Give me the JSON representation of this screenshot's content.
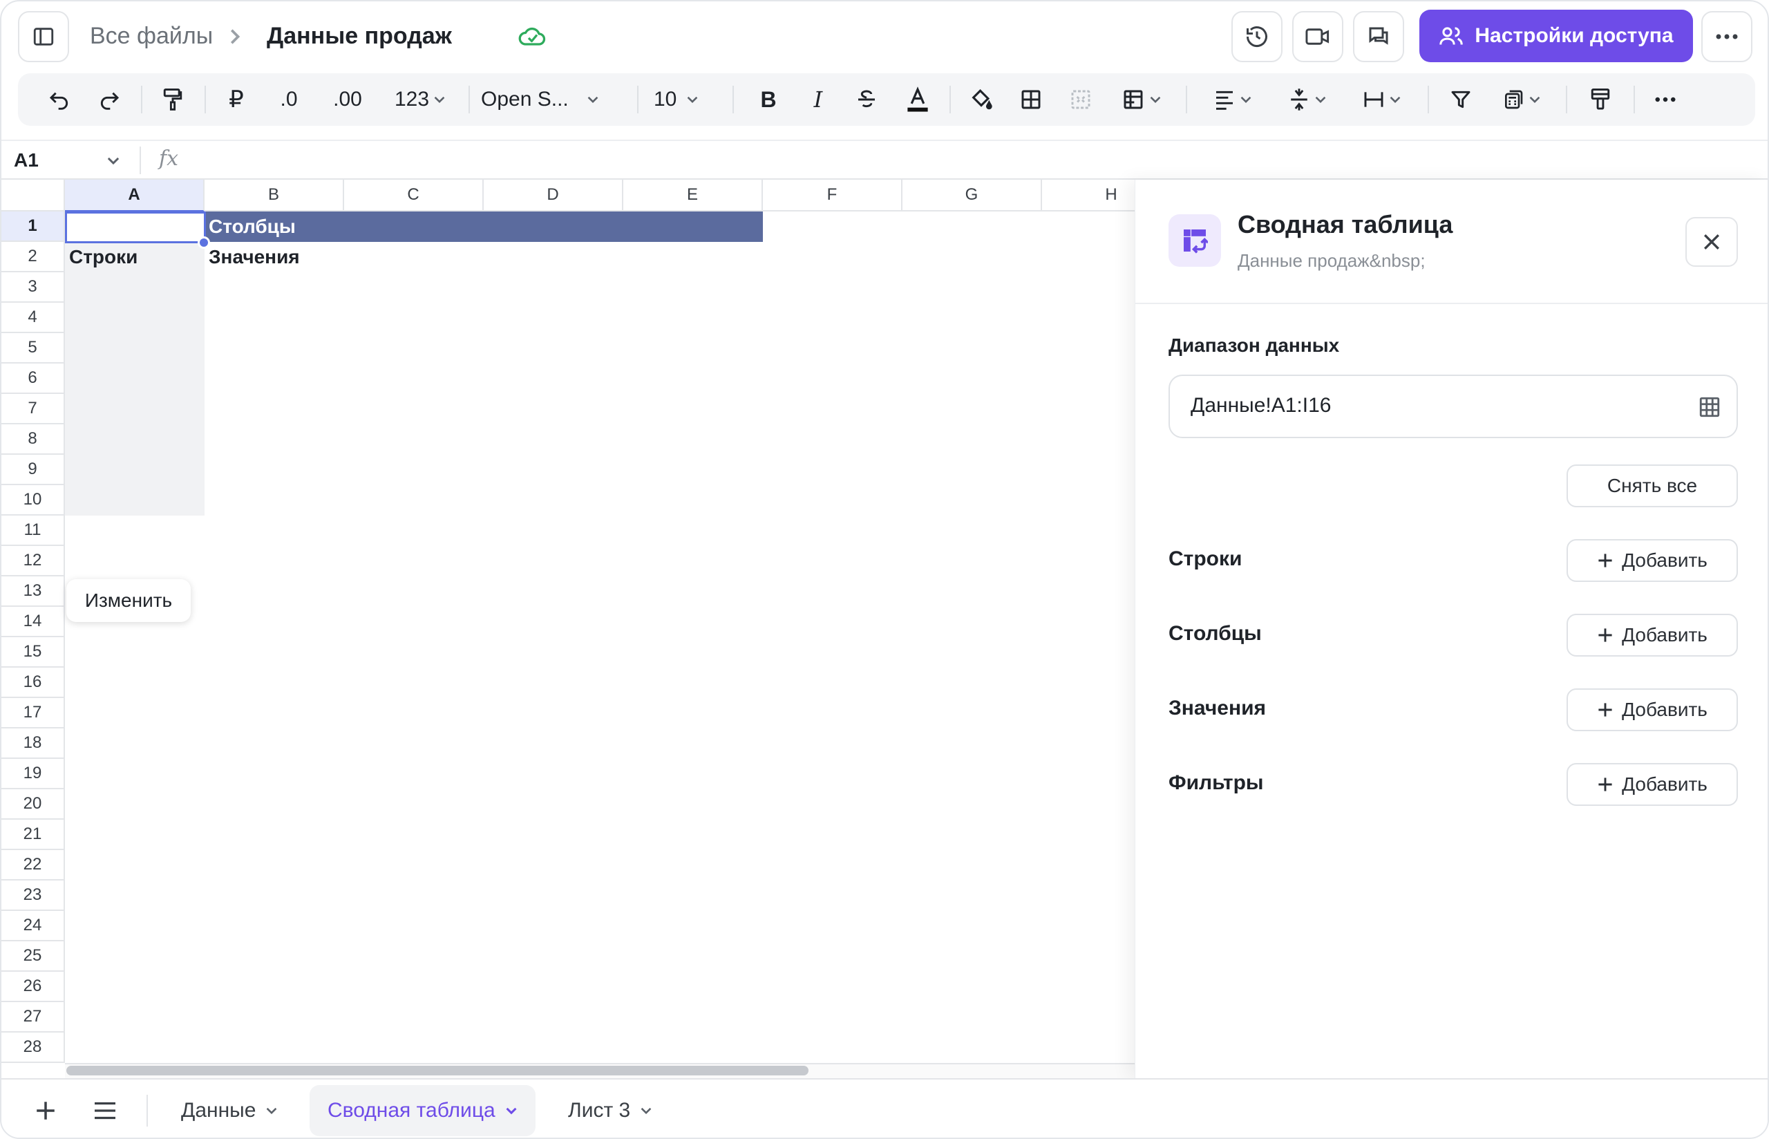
{
  "header": {
    "breadcrumb_root": "Все файлы",
    "file_title": "Данные продаж",
    "share_label": "Настройки доступа"
  },
  "toolbar": {
    "decrease_decimals": ".0",
    "increase_decimals": ".00",
    "number_format": "123",
    "font_name": "Open S...",
    "font_size": "10"
  },
  "formula_bar": {
    "cell_ref": "A1",
    "fx": "fx"
  },
  "grid": {
    "columns": [
      "A",
      "B",
      "C",
      "D",
      "E",
      "F",
      "G",
      "H"
    ],
    "rows": [
      "1",
      "2",
      "3",
      "4",
      "5",
      "6",
      "7",
      "8",
      "9",
      "10",
      "11",
      "12",
      "13",
      "14",
      "15",
      "16",
      "17",
      "18",
      "19",
      "20",
      "21",
      "22",
      "23",
      "24",
      "25",
      "26",
      "27",
      "28"
    ],
    "pivot_columns_label": "Столбцы",
    "pivot_rows_label": "Строки",
    "pivot_values_label": "Значения",
    "edit_popup": "Изменить",
    "header_fill": "#5b6b9e"
  },
  "panel": {
    "title": "Сводная таблица",
    "subtitle": "Данные продаж&nbsp;",
    "range_label": "Диапазон данных",
    "range_value": "Данные!A1:I16",
    "clear_all": "Снять все",
    "add_label": "Добавить",
    "sections": [
      "Строки",
      "Столбцы",
      "Значения",
      "Фильтры"
    ]
  },
  "sheets": {
    "tabs": [
      "Данные",
      "Сводная таблица",
      "Лист 3"
    ],
    "active_tab": "Сводная таблица"
  },
  "colors": {
    "accent": "#6e4ce8",
    "sync_ok": "#2eab5c"
  }
}
